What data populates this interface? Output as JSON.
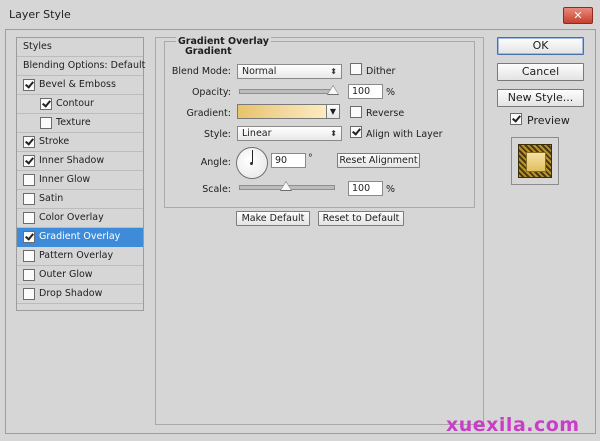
{
  "window": {
    "title": "Layer Style",
    "close_glyph": "✕"
  },
  "styles_list": {
    "header": "Styles",
    "blending": "Blending Options: Default",
    "items": [
      {
        "label": "Bevel & Emboss",
        "checked": true
      },
      {
        "label": "Contour",
        "checked": true
      },
      {
        "label": "Texture",
        "checked": false
      },
      {
        "label": "Stroke",
        "checked": true
      },
      {
        "label": "Inner Shadow",
        "checked": true
      },
      {
        "label": "Inner Glow",
        "checked": false
      },
      {
        "label": "Satin",
        "checked": false
      },
      {
        "label": "Color Overlay",
        "checked": false
      },
      {
        "label": "Gradient Overlay",
        "checked": true,
        "selected": true
      },
      {
        "label": "Pattern Overlay",
        "checked": false
      },
      {
        "label": "Outer Glow",
        "checked": false
      },
      {
        "label": "Drop Shadow",
        "checked": false
      }
    ]
  },
  "gradient_overlay": {
    "title": "Gradient Overlay",
    "subtitle": "Gradient",
    "blend_mode": {
      "label": "Blend Mode:",
      "value": "Normal"
    },
    "dither": {
      "label": "Dither",
      "checked": false
    },
    "opacity": {
      "label": "Opacity:",
      "value": "100",
      "unit": "%",
      "level": 1.0
    },
    "gradient": {
      "label": "Gradient:",
      "colors": [
        "#e6c46c",
        "#f1d79a",
        "#fbecc2"
      ]
    },
    "reverse": {
      "label": "Reverse",
      "checked": false
    },
    "style": {
      "label": "Style:",
      "value": "Linear"
    },
    "align_with_layer": {
      "label": "Align with Layer",
      "checked": true
    },
    "angle": {
      "label": "Angle:",
      "value": "90",
      "unit": "°"
    },
    "reset_alignment": "Reset Alignment",
    "scale": {
      "label": "Scale:",
      "value": "100",
      "unit": "%",
      "level": 0.5
    },
    "make_default": "Make Default",
    "reset_to_default": "Reset to Default"
  },
  "actions": {
    "ok": "OK",
    "cancel": "Cancel",
    "new_style": "New Style...",
    "preview": {
      "label": "Preview",
      "checked": true
    }
  },
  "watermark": "xuexila.com",
  "colors": {
    "selection": "#3d8bd9",
    "watermark": "#c93ec6",
    "close": "#c6402e"
  }
}
